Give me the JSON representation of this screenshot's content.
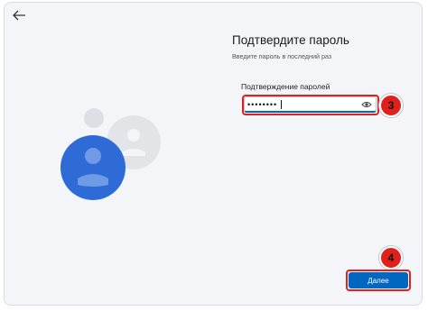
{
  "header": {
    "back_icon": "arrow-left-icon"
  },
  "main": {
    "title": "Подтвердите пароль",
    "subtitle": "Введите пароль в последний раз",
    "password_field": {
      "label": "Подтверждение паролей",
      "value": "••••••••",
      "reveal_icon": "eye-icon"
    },
    "next_button": {
      "label": "Далее"
    }
  },
  "annotations": {
    "step_field": "3",
    "step_button": "4"
  },
  "colors": {
    "accent": "#0067c0",
    "highlight": "#e0201c"
  }
}
